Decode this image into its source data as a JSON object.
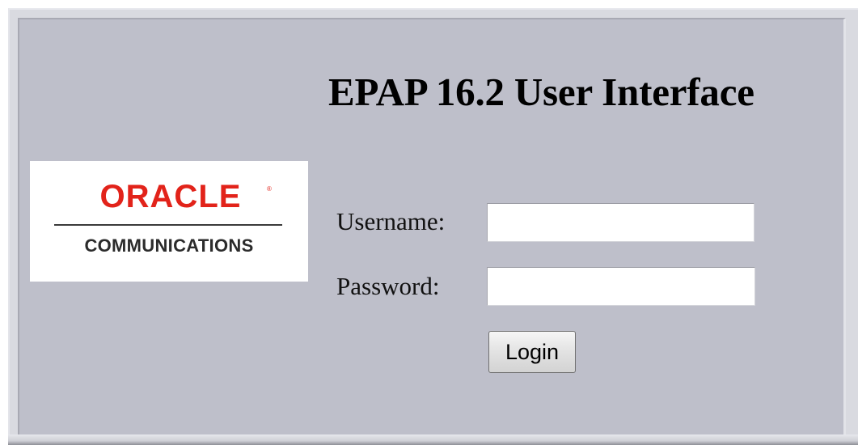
{
  "page": {
    "title": "EPAP 16.2 User Interface"
  },
  "logo": {
    "brand": "ORACLE",
    "registered_mark": "®",
    "subtitle": "COMMUNICATIONS",
    "brand_color": "#e2231a"
  },
  "login_form": {
    "username_label": "Username:",
    "username_value": "",
    "password_label": "Password:",
    "password_value": "",
    "login_label": "Login"
  },
  "colors": {
    "panel_background": "#bebfca",
    "title_text": "#000000"
  }
}
